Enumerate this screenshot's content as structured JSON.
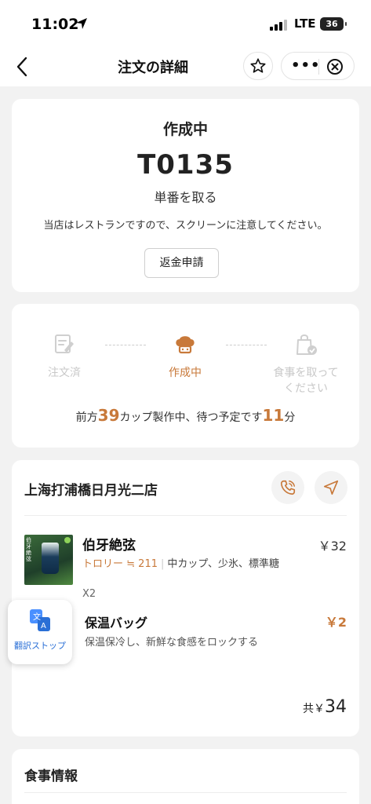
{
  "status_bar": {
    "time": "11:02",
    "network": "LTE",
    "battery": "36"
  },
  "nav": {
    "title": "注文の詳細",
    "more": "•••"
  },
  "order": {
    "status": "作成中",
    "number": "T0135",
    "pickup": "単番を取る",
    "notice": "当店はレストランですので、スクリーンに注意してください。",
    "refund_label": "返金申請"
  },
  "progress": {
    "steps": [
      {
        "label": "注文済",
        "state": "done",
        "icon": "order-form-icon"
      },
      {
        "label": "作成中",
        "state": "active",
        "icon": "chef-hat-icon"
      },
      {
        "label": "食事を取って\nください",
        "state": "todo",
        "icon": "pickup-bag-icon"
      }
    ],
    "queue_prefix": "前方",
    "queue_cups": "39",
    "queue_middle": "カップ製作中、待つ予定です",
    "queue_minutes": "11",
    "queue_suffix": "分"
  },
  "store": {
    "name": "上海打浦橋日月光二店",
    "items": [
      {
        "name": "伯牙絶弦",
        "price": "￥32",
        "topping": "トロリー ≒ 211",
        "options": "中カップ、少氷、標準糖",
        "qty": "X2",
        "thumb_text": "伯牙絶弦"
      }
    ],
    "addon": {
      "name": "保温バッグ",
      "price": "￥2",
      "desc": "保温保冷し、新鮮な食感をロックする"
    },
    "total_prefix": "共￥",
    "total_amount": "34"
  },
  "translate": {
    "label": "翻訳ストップ"
  },
  "meal_info": {
    "title": "食事情報"
  },
  "colors": {
    "accent": "#c8793a",
    "muted": "#c8c8c8",
    "link": "#2a6fd6"
  }
}
